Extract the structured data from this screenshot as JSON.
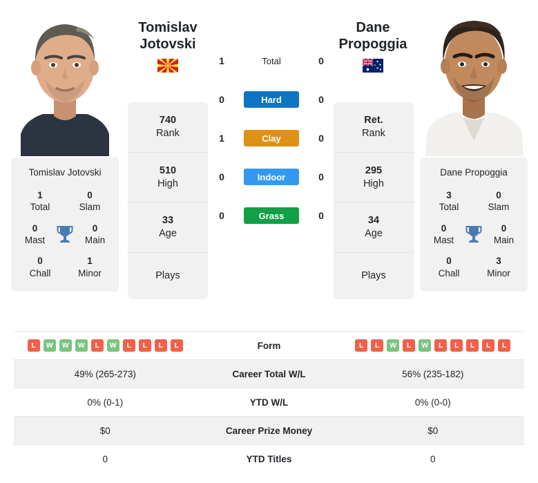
{
  "colors": {
    "hard": "#0d75c3",
    "clay": "#df9016",
    "indoor": "#3498f0",
    "grass": "#11a045",
    "win": "#7bc47f",
    "loss": "#f0614a",
    "trophy": "#4a7ab5",
    "card_bg": "#f1f1f1"
  },
  "left_player": {
    "first_name": "Tomislav",
    "last_name": "Jotovski",
    "full_name": "Tomislav Jotovski",
    "country": "North Macedonia",
    "flag_icon": "flag-north-macedonia",
    "photo_alt": "Tomislav Jotovski",
    "titles": [
      {
        "value": "1",
        "label": "Total"
      },
      {
        "value": "0",
        "label": "Slam"
      },
      {
        "value": "0",
        "label": "Mast"
      },
      {
        "value": "0",
        "label": "Main"
      },
      {
        "value": "0",
        "label": "Chall"
      },
      {
        "value": "1",
        "label": "Minor"
      }
    ],
    "stats": [
      {
        "value": "740",
        "label": "Rank"
      },
      {
        "value": "510",
        "label": "High"
      },
      {
        "value": "33",
        "label": "Age"
      },
      {
        "value": "",
        "label": "Plays"
      }
    ],
    "form": [
      "L",
      "W",
      "W",
      "W",
      "L",
      "W",
      "L",
      "L",
      "L",
      "L"
    ],
    "career_total_wl": "49% (265-273)",
    "ytd_wl": "0% (0-1)",
    "career_prize_money": "$0",
    "ytd_titles": "0",
    "h2h": {
      "total": "1",
      "hard": "0",
      "clay": "1",
      "indoor": "0",
      "grass": "0"
    }
  },
  "right_player": {
    "first_name": "Dane",
    "last_name": "Propoggia",
    "full_name": "Dane Propoggia",
    "country": "Australia",
    "flag_icon": "flag-australia",
    "photo_alt": "Dane Propoggia",
    "titles": [
      {
        "value": "3",
        "label": "Total"
      },
      {
        "value": "0",
        "label": "Slam"
      },
      {
        "value": "0",
        "label": "Mast"
      },
      {
        "value": "0",
        "label": "Main"
      },
      {
        "value": "0",
        "label": "Chall"
      },
      {
        "value": "3",
        "label": "Minor"
      }
    ],
    "stats": [
      {
        "value": "Ret.",
        "label": "Rank"
      },
      {
        "value": "295",
        "label": "High"
      },
      {
        "value": "34",
        "label": "Age"
      },
      {
        "value": "",
        "label": "Plays"
      }
    ],
    "form": [
      "L",
      "L",
      "W",
      "L",
      "W",
      "L",
      "L",
      "L",
      "L",
      "L"
    ],
    "career_total_wl": "56% (235-182)",
    "ytd_wl": "0% (0-0)",
    "career_prize_money": "$0",
    "ytd_titles": "0",
    "h2h": {
      "total": "0",
      "hard": "0",
      "clay": "0",
      "indoor": "0",
      "grass": "0"
    }
  },
  "surfaces": [
    {
      "key": "total",
      "label": "Total",
      "style": "plain"
    },
    {
      "key": "hard",
      "label": "Hard",
      "style": "hard"
    },
    {
      "key": "clay",
      "label": "Clay",
      "style": "clay"
    },
    {
      "key": "indoor",
      "label": "Indoor",
      "style": "indoor"
    },
    {
      "key": "grass",
      "label": "Grass",
      "style": "grass"
    }
  ],
  "table_labels": {
    "form": "Form",
    "career_total_wl": "Career Total W/L",
    "ytd_wl": "YTD W/L",
    "career_prize_money": "Career Prize Money",
    "ytd_titles": "YTD Titles"
  }
}
